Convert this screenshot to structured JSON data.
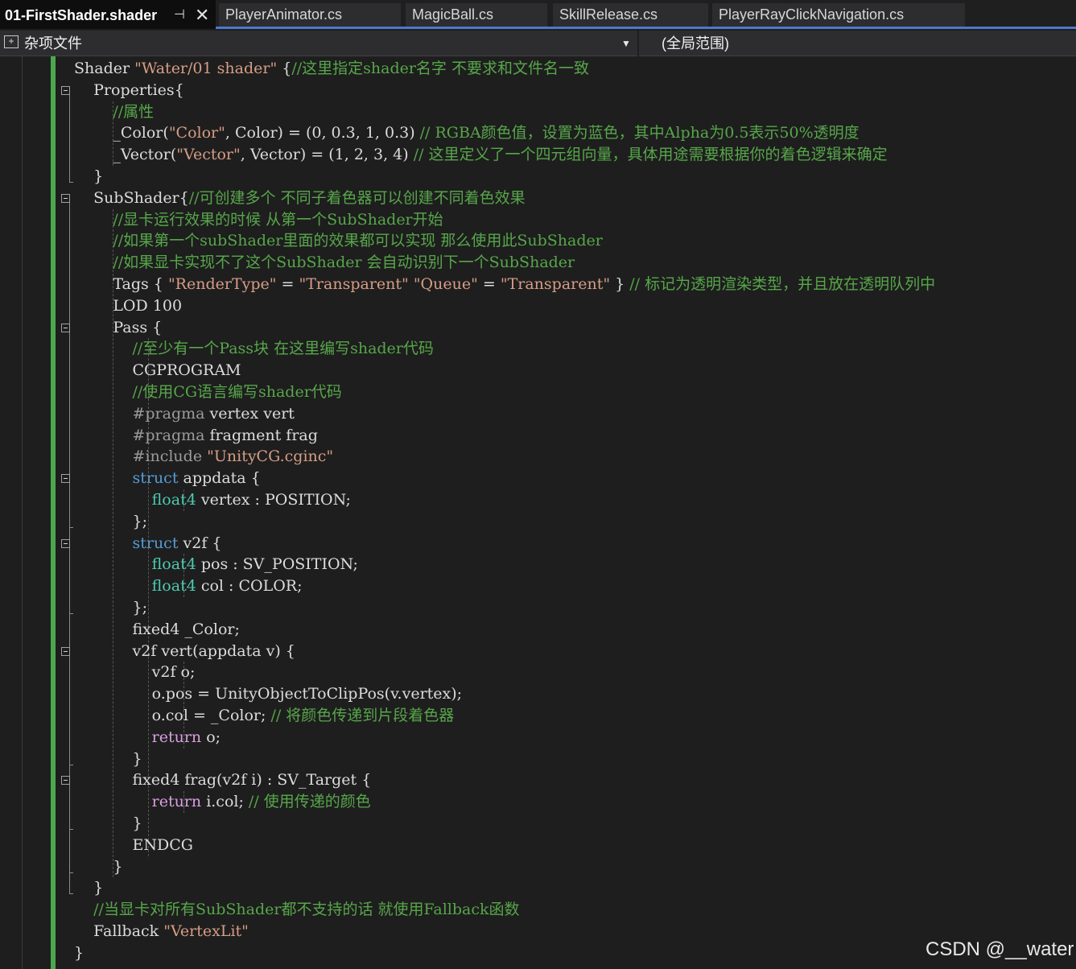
{
  "tabs": [
    {
      "label": "01-FirstShader.shader",
      "active": true
    },
    {
      "label": "PlayerAnimator.cs",
      "active": false
    },
    {
      "label": "MagicBall.cs",
      "active": false
    },
    {
      "label": "SkillRelease.cs",
      "active": false
    },
    {
      "label": "PlayerRayClickNavigation.cs",
      "active": false
    }
  ],
  "tab_icons": {
    "pin": "pin-icon",
    "close": "close-icon"
  },
  "navbar": {
    "project_label": "杂项文件",
    "scope_label": "(全局范围)",
    "project_icon": "misc-files-icon",
    "dropdown_icon": "chevron-down-icon"
  },
  "code_lines": [
    [
      [
        "",
        "Shader "
      ],
      [
        "str",
        "\"Water/01 shader\""
      ],
      [
        "",
        " {"
      ],
      [
        "cm",
        "//这里指定shader名字 不要求和文件名一致"
      ]
    ],
    [
      [
        "",
        "    Properties{"
      ]
    ],
    [
      [
        "cm",
        "        //属性"
      ]
    ],
    [
      [
        "",
        "        _Color("
      ],
      [
        "str",
        "\"Color\""
      ],
      [
        "",
        ", Color) = (0, 0.3, 1, 0.3) "
      ],
      [
        "cm",
        "// RGBA颜色值，设置为蓝色，其中Alpha为0.5表示50%透明度"
      ]
    ],
    [
      [
        "",
        "        _Vector("
      ],
      [
        "str",
        "\"Vector\""
      ],
      [
        "",
        ", Vector) = (1, 2, 3, 4) "
      ],
      [
        "cm",
        "// 这里定义了一个四元组向量，具体用途需要根据你的着色逻辑来确定"
      ]
    ],
    [
      [
        "",
        "    }"
      ]
    ],
    [
      [
        "",
        "    SubShader{"
      ],
      [
        "cm",
        "//可创建多个 不同子着色器可以创建不同着色效果"
      ]
    ],
    [
      [
        "cm",
        "        //显卡运行效果的时候 从第一个SubShader开始"
      ]
    ],
    [
      [
        "cm",
        "        //如果第一个subShader里面的效果都可以实现 那么使用此SubShader"
      ]
    ],
    [
      [
        "cm",
        "        //如果显卡实现不了这个SubShader 会自动识别下一个SubShader"
      ]
    ],
    [
      [
        "",
        "        Tags { "
      ],
      [
        "str",
        "\"RenderType\""
      ],
      [
        "",
        " = "
      ],
      [
        "str",
        "\"Transparent\""
      ],
      [
        "",
        " "
      ],
      [
        "str",
        "\"Queue\""
      ],
      [
        "",
        " = "
      ],
      [
        "str",
        "\"Transparent\""
      ],
      [
        "",
        " } "
      ],
      [
        "cm",
        "// 标记为透明渲染类型，并且放在透明队列中"
      ]
    ],
    [
      [
        "",
        "        LOD 100"
      ]
    ],
    [
      [
        "",
        "        Pass {"
      ]
    ],
    [
      [
        "cm",
        "            //至少有一个Pass块 在这里编写shader代码"
      ]
    ],
    [
      [
        "",
        "            CGPROGRAM"
      ]
    ],
    [
      [
        "cm",
        "            //使用CG语言编写shader代码"
      ]
    ],
    [
      [
        "pp",
        "            #pragma"
      ],
      [
        "",
        " vertex vert"
      ]
    ],
    [
      [
        "pp",
        "            #pragma"
      ],
      [
        "",
        " fragment frag"
      ]
    ],
    [
      [
        "pp",
        "            #include"
      ],
      [
        "",
        " "
      ],
      [
        "str",
        "\"UnityCG.cginc\""
      ]
    ],
    [
      [
        "kw",
        "            struct"
      ],
      [
        "",
        " appdata {"
      ]
    ],
    [
      [
        "ty",
        "                float4"
      ],
      [
        "",
        " vertex : POSITION;"
      ]
    ],
    [
      [
        "",
        "            };"
      ]
    ],
    [
      [
        "kw",
        "            struct"
      ],
      [
        "",
        " v2f {"
      ]
    ],
    [
      [
        "ty",
        "                float4"
      ],
      [
        "",
        " pos : SV_POSITION;"
      ]
    ],
    [
      [
        "ty",
        "                float4"
      ],
      [
        "",
        " col : COLOR;"
      ]
    ],
    [
      [
        "",
        "            };"
      ]
    ],
    [
      [
        "",
        "            fixed4 _Color;"
      ]
    ],
    [
      [
        "",
        "            v2f vert(appdata v) {"
      ]
    ],
    [
      [
        "",
        "                v2f o;"
      ]
    ],
    [
      [
        "",
        "                o.pos = UnityObjectToClipPos(v.vertex);"
      ]
    ],
    [
      [
        "",
        "                o.col = _Color; "
      ],
      [
        "cm",
        "// 将颜色传递到片段着色器"
      ]
    ],
    [
      [
        "ctl",
        "                return"
      ],
      [
        "",
        " o;"
      ]
    ],
    [
      [
        "",
        "            }"
      ]
    ],
    [
      [
        "",
        "            fixed4 frag(v2f i) : SV_Target {"
      ]
    ],
    [
      [
        "ctl",
        "                return"
      ],
      [
        "",
        " i.col; "
      ],
      [
        "cm",
        "// 使用传递的颜色"
      ]
    ],
    [
      [
        "",
        "            }"
      ]
    ],
    [
      [
        "",
        "            ENDCG"
      ]
    ],
    [
      [
        "",
        "        }"
      ]
    ],
    [
      [
        "",
        "    }"
      ]
    ],
    [
      [
        "cm",
        "    //当显卡对所有SubShader都不支持的话 就使用Fallback函数"
      ]
    ],
    [
      [
        "",
        "    Fallback "
      ],
      [
        "str",
        "\"VertexLit\""
      ]
    ],
    [
      [
        "",
        "}"
      ]
    ]
  ],
  "fold_markers": [
    1,
    6,
    12,
    19,
    22,
    27,
    33
  ],
  "fold_icon": "collapse-icon",
  "watermark": "CSDN @__water"
}
